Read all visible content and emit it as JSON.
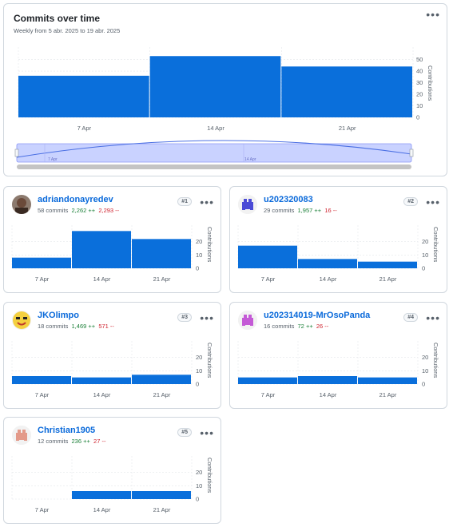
{
  "overview": {
    "title": "Commits over time",
    "subtitle": "Weekly from 5 abr. 2025 to 19 abr. 2025",
    "more_label": "•••",
    "chart_data": {
      "type": "bar",
      "categories": [
        "7 Apr",
        "14 Apr",
        "21 Apr"
      ],
      "values": [
        36,
        53,
        44
      ],
      "ylabel": "Contributions",
      "yticks": [
        0,
        10,
        20,
        30,
        40,
        50
      ],
      "ylim": [
        0,
        58
      ],
      "grid": true,
      "color": "#0a6fdb"
    },
    "brush": {
      "labels": [
        "7 Apr",
        "14 Apr"
      ]
    }
  },
  "contributors": [
    {
      "name": "adriandonayredev",
      "commits": "58 commits",
      "additions": "2,262 ++",
      "deletions": "2,293 --",
      "rank": "#1",
      "avatar": "photo-avatar",
      "avatar_color": "#6b4a3a",
      "chart_data": {
        "type": "bar",
        "categories": [
          "7 Apr",
          "14 Apr",
          "21 Apr"
        ],
        "values": [
          8,
          28,
          22
        ],
        "ylabel": "Contributions",
        "yticks": [
          0,
          10,
          20
        ],
        "ylim": [
          0,
          30
        ]
      }
    },
    {
      "name": "u202320083",
      "commits": "29 commits",
      "additions": "1,957 ++",
      "deletions": "16 --",
      "rank": "#2",
      "avatar": "identicon-avatar",
      "avatar_color": "#4b4bd6",
      "chart_data": {
        "type": "bar",
        "categories": [
          "7 Apr",
          "14 Apr",
          "21 Apr"
        ],
        "values": [
          17,
          7,
          5
        ],
        "ylabel": "Contributions",
        "yticks": [
          0,
          10,
          20
        ],
        "ylim": [
          0,
          30
        ]
      }
    },
    {
      "name": "JKOlimpo",
      "commits": "18 commits",
      "additions": "1,469 ++",
      "deletions": "571 --",
      "rank": "#3",
      "avatar": "emoji-avatar",
      "avatar_color": "#f4d03f",
      "chart_data": {
        "type": "bar",
        "categories": [
          "7 Apr",
          "14 Apr",
          "21 Apr"
        ],
        "values": [
          6,
          5,
          7
        ],
        "ylabel": "Contributions",
        "yticks": [
          0,
          10,
          20
        ],
        "ylim": [
          0,
          30
        ]
      }
    },
    {
      "name": "u202314019-MrOsoPanda",
      "commits": "16 commits",
      "additions": "72 ++",
      "deletions": "26 --",
      "rank": "#4",
      "avatar": "identicon-avatar",
      "avatar_color": "#c45ad6",
      "chart_data": {
        "type": "bar",
        "categories": [
          "7 Apr",
          "14 Apr",
          "21 Apr"
        ],
        "values": [
          5,
          6,
          5
        ],
        "ylabel": "Contributions",
        "yticks": [
          0,
          10,
          20
        ],
        "ylim": [
          0,
          30
        ]
      }
    },
    {
      "name": "Christian1905",
      "commits": "12 commits",
      "additions": "236 ++",
      "deletions": "27 --",
      "rank": "#5",
      "avatar": "identicon-avatar",
      "avatar_color": "#e39a8a",
      "chart_data": {
        "type": "bar",
        "categories": [
          "7 Apr",
          "14 Apr",
          "21 Apr"
        ],
        "values": [
          0,
          6,
          6
        ],
        "ylabel": "Contributions",
        "yticks": [
          0,
          10,
          20
        ],
        "ylim": [
          0,
          30
        ]
      }
    }
  ]
}
